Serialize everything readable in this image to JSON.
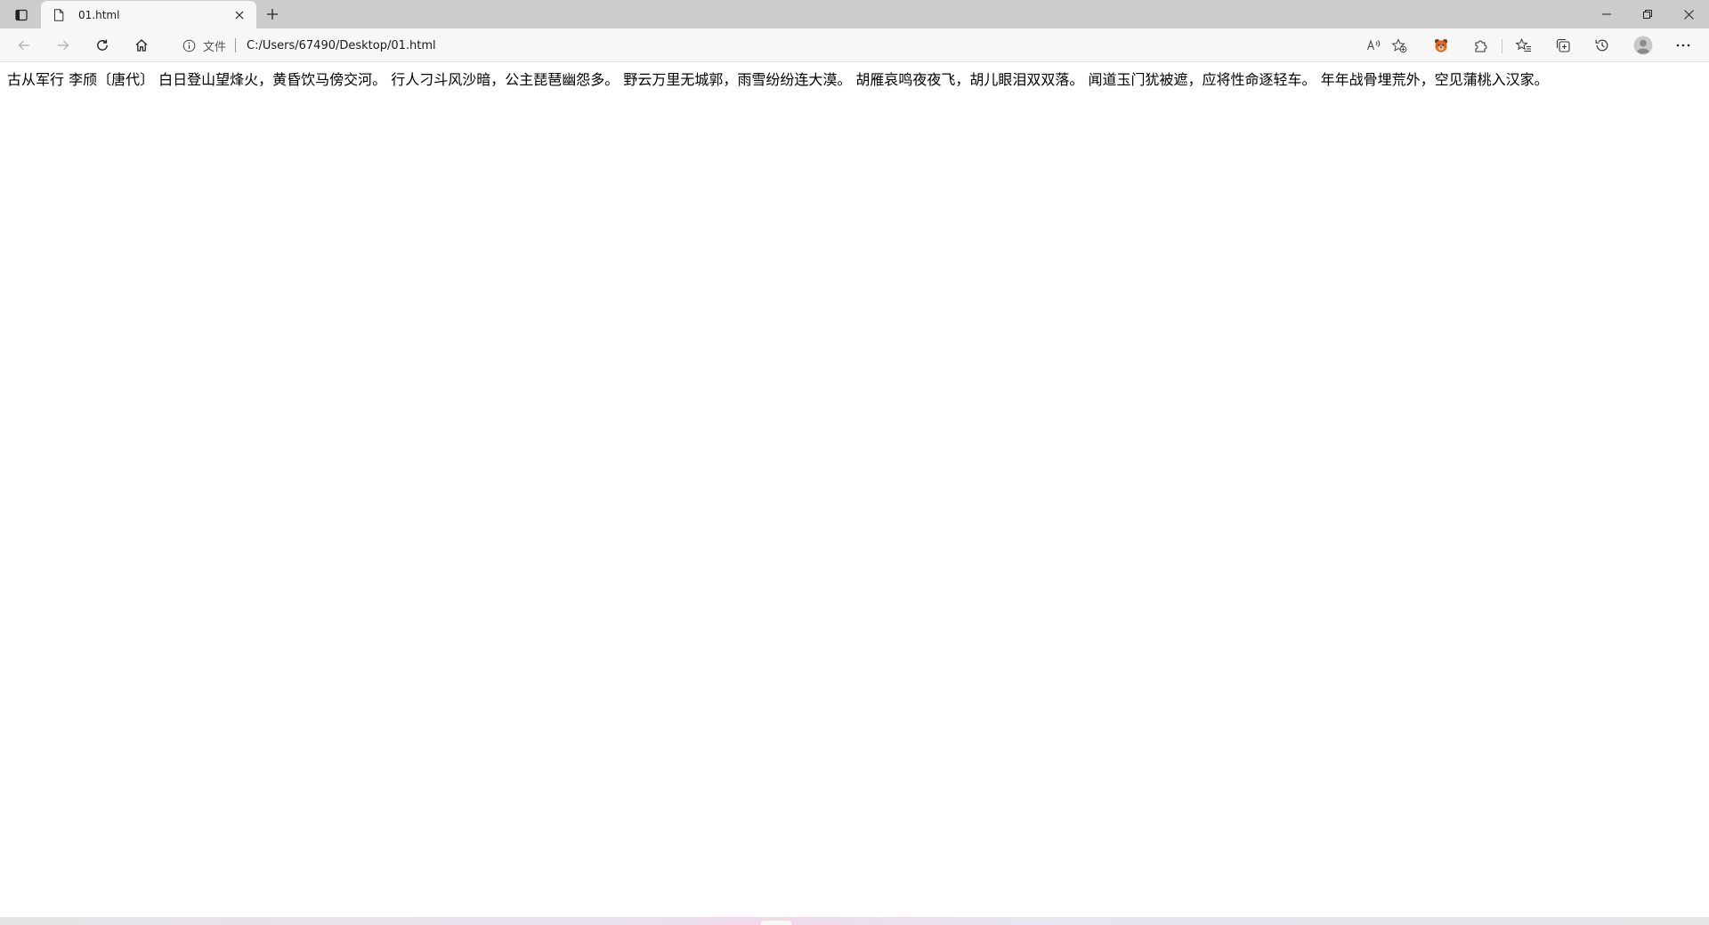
{
  "browser": {
    "tab": {
      "title": "01.html"
    },
    "toolbar": {
      "scheme_label": "文件",
      "url": "C:/Users/67490/Desktop/01.html"
    },
    "icons": {
      "tab_actions": "tab-actions-icon",
      "tab_favicon": "document-icon",
      "tab_close": "close-icon",
      "new_tab": "plus-icon",
      "minimize": "minimize-icon",
      "restore": "restore-icon",
      "close_window": "close-icon",
      "back": "back-arrow-icon",
      "forward": "forward-arrow-icon",
      "refresh": "refresh-icon",
      "home": "home-icon",
      "info": "info-icon",
      "read_aloud": "read-aloud-icon",
      "add_favorite": "add-favorite-icon",
      "extension_1": "bear-extension-icon",
      "extensions": "puzzle-icon",
      "favorites": "favorites-icon",
      "collections": "collections-icon",
      "history": "history-icon",
      "profile": "profile-avatar-icon",
      "more": "more-icon"
    }
  },
  "page": {
    "text": "古从军行 李颀〔唐代〕 白日登山望烽火，黄昏饮马傍交河。 行人刁斗风沙暗，公主琵琶幽怨多。 野云万里无城郭，雨雪纷纷连大漠。 胡雁哀鸣夜夜飞，胡儿眼泪双双落。 闻道玉门犹被遮，应将性命逐轻车。 年年战骨埋荒外，空见蒲桃入汉家。"
  }
}
